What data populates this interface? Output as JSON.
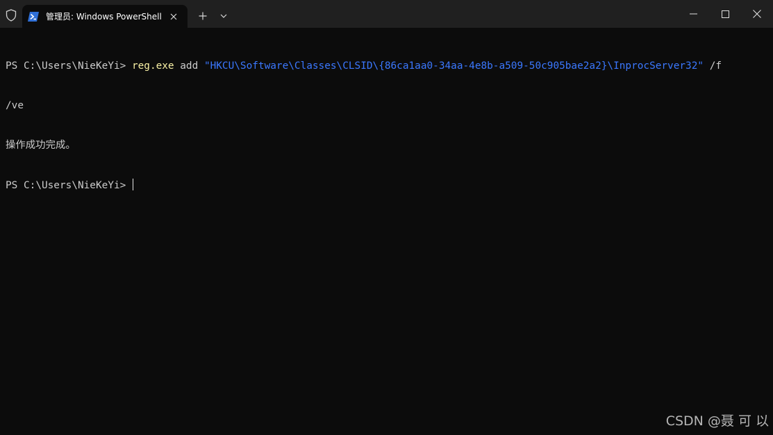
{
  "titlebar": {
    "tab_title": "管理员: Windows PowerShell"
  },
  "icons": {
    "shield": "shield-icon",
    "powershell": "powershell-icon",
    "tab_close": "close-icon",
    "new_tab": "plus-icon",
    "dropdown": "chevron-down-icon",
    "minimize": "minimize-icon",
    "maximize": "maximize-icon",
    "close": "close-icon"
  },
  "terminal": {
    "line1": {
      "prompt": "PS C:\\Users\\NieKeYi> ",
      "command": "reg.exe",
      "arg": " add ",
      "string": "\"HKCU\\Software\\Classes\\CLSID\\{86ca1aa0-34aa-4e8b-a509-50c905bae2a2}\\InprocServer32\"",
      "flag": " /f"
    },
    "line2": "/ve",
    "line3": "操作成功完成。",
    "line4_prompt": "PS C:\\Users\\NieKeYi> "
  },
  "watermark": "CSDN @聂 可 以",
  "colors": {
    "background": "#0c0c0c",
    "titlebar": "#202020",
    "command": "#f9f1a5",
    "string": "#3b78ff",
    "text": "#cccccc"
  }
}
